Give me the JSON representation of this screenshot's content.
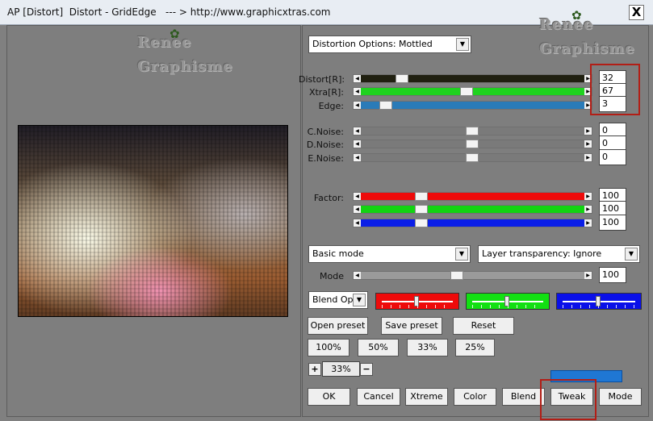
{
  "window": {
    "title": "AP [Distort]  Distort - GridEdge   --- > http://www.graphicxtras.com",
    "close_symbol": "X"
  },
  "watermark": {
    "line1": "Renee",
    "line2": "Graphisme"
  },
  "distortion_options": "Distortion Options: Mottled",
  "sliders": {
    "distort": {
      "label": "Distort[R]:",
      "value": "32",
      "color": "#202010"
    },
    "xtra": {
      "label": "Xtra[R]:",
      "value": "67",
      "color": "#1fd21f"
    },
    "edge": {
      "label": "Edge:",
      "value": "3",
      "color": "#2a7bb8"
    },
    "cnoise": {
      "label": "C.Noise:",
      "value": "0"
    },
    "dnoise": {
      "label": "D.Noise:",
      "value": "0"
    },
    "enoise": {
      "label": "E.Noise:",
      "value": "0"
    },
    "factor_label": "Factor:",
    "factor_red": {
      "value": "100",
      "color": "#ee0a0a"
    },
    "factor_green": {
      "value": "100",
      "color": "#12d412"
    },
    "factor_blue": {
      "value": "100",
      "color": "#0a1ee8"
    }
  },
  "mode_select": "Basic mode",
  "layer_transparency": "Layer transparency: Ignore",
  "mode_slider": {
    "label": "Mode",
    "value": "100"
  },
  "blend_options": "Blend Optio",
  "blend_swatches": {
    "red": "#ee0a0a",
    "green": "#12e012",
    "blue": "#0a10e8"
  },
  "preset_buttons": {
    "open": "Open preset",
    "save": "Save preset",
    "reset": "Reset"
  },
  "zoom_buttons": [
    "100%",
    "50%",
    "33%",
    "25%"
  ],
  "zoom": {
    "plus": "+",
    "value": "33%",
    "minus": "−"
  },
  "bottom_buttons": {
    "ok": "OK",
    "cancel": "Cancel",
    "xtreme": "Xtreme",
    "color": "Color",
    "blend": "Blend",
    "tweak": "Tweak",
    "mode": "Mode"
  },
  "accent_color": "#1f77d4",
  "highlight_color": "#b21e16"
}
